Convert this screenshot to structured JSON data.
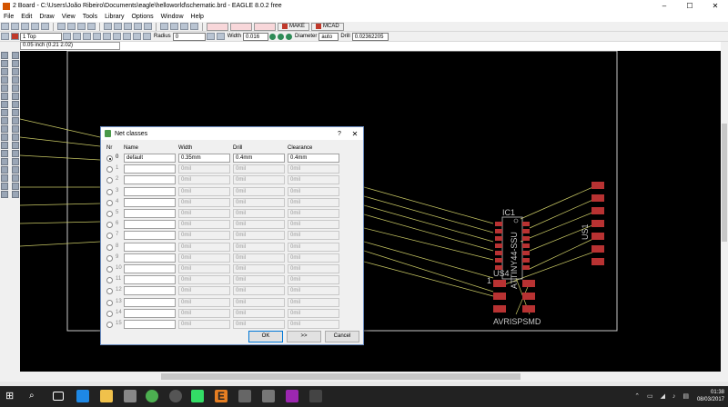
{
  "window": {
    "title": "2 Board - C:\\Users\\João Ribeiro\\Documents\\eagle\\helloworld\\schematic.brd - EAGLE 8.0.2 free",
    "minimize": "–",
    "maximize": "☐",
    "close": "✕"
  },
  "menu": [
    "File",
    "Edit",
    "Draw",
    "View",
    "Tools",
    "Library",
    "Options",
    "Window",
    "Help"
  ],
  "toolbar1": {
    "layer": "1 Top",
    "radius_label": "Radius",
    "radius_value": "0",
    "width_label": "Width",
    "width_value": "0.016",
    "diameter_label": "Diameter",
    "diameter_value": "auto",
    "drill_label": "Drill",
    "drill_value": "0.02362205",
    "make_label": "MAKE",
    "mcad_label": "MCAD"
  },
  "coords": "0.05 inch (0.21 2.02)",
  "dialog": {
    "title": "Net classes",
    "help": "?",
    "close": "✕",
    "headers": {
      "nr": "Nr",
      "name": "Name",
      "width": "Width",
      "drill": "Drill",
      "clearance": "Clearance"
    },
    "rows": [
      {
        "nr": "0",
        "name": "default",
        "width": "0.35mm",
        "drill": "0.4mm",
        "clearance": "0.4mm",
        "selected": true
      },
      {
        "nr": "1",
        "name": "",
        "width": "0mil",
        "drill": "0mil",
        "clearance": "0mil"
      },
      {
        "nr": "2",
        "name": "",
        "width": "0mil",
        "drill": "0mil",
        "clearance": "0mil"
      },
      {
        "nr": "3",
        "name": "",
        "width": "0mil",
        "drill": "0mil",
        "clearance": "0mil"
      },
      {
        "nr": "4",
        "name": "",
        "width": "0mil",
        "drill": "0mil",
        "clearance": "0mil"
      },
      {
        "nr": "5",
        "name": "",
        "width": "0mil",
        "drill": "0mil",
        "clearance": "0mil"
      },
      {
        "nr": "6",
        "name": "",
        "width": "0mil",
        "drill": "0mil",
        "clearance": "0mil"
      },
      {
        "nr": "7",
        "name": "",
        "width": "0mil",
        "drill": "0mil",
        "clearance": "0mil"
      },
      {
        "nr": "8",
        "name": "",
        "width": "0mil",
        "drill": "0mil",
        "clearance": "0mil"
      },
      {
        "nr": "9",
        "name": "",
        "width": "0mil",
        "drill": "0mil",
        "clearance": "0mil"
      },
      {
        "nr": "10",
        "name": "",
        "width": "0mil",
        "drill": "0mil",
        "clearance": "0mil"
      },
      {
        "nr": "11",
        "name": "",
        "width": "0mil",
        "drill": "0mil",
        "clearance": "0mil"
      },
      {
        "nr": "12",
        "name": "",
        "width": "0mil",
        "drill": "0mil",
        "clearance": "0mil"
      },
      {
        "nr": "13",
        "name": "",
        "width": "0mil",
        "drill": "0mil",
        "clearance": "0mil"
      },
      {
        "nr": "14",
        "name": "",
        "width": "0mil",
        "drill": "0mil",
        "clearance": "0mil"
      },
      {
        "nr": "15",
        "name": "",
        "width": "0mil",
        "drill": "0mil",
        "clearance": "0mil"
      }
    ],
    "buttons": {
      "ok": "OK",
      "more": ">>",
      "cancel": "Cancel"
    }
  },
  "board": {
    "ic_label": "IC1",
    "ic_value": "ATTINY44-SSU",
    "us4_label": "US4",
    "pin1": "1",
    "avr_label": "AVRISPSMD",
    "us1_label": "US1"
  },
  "colors": {
    "pad": "#b83232",
    "airwire": "#c8c864",
    "outline": "#c8c8c8",
    "canvas": "#000000"
  },
  "tray": {
    "time": "01:38",
    "date": "08/03/2017"
  }
}
